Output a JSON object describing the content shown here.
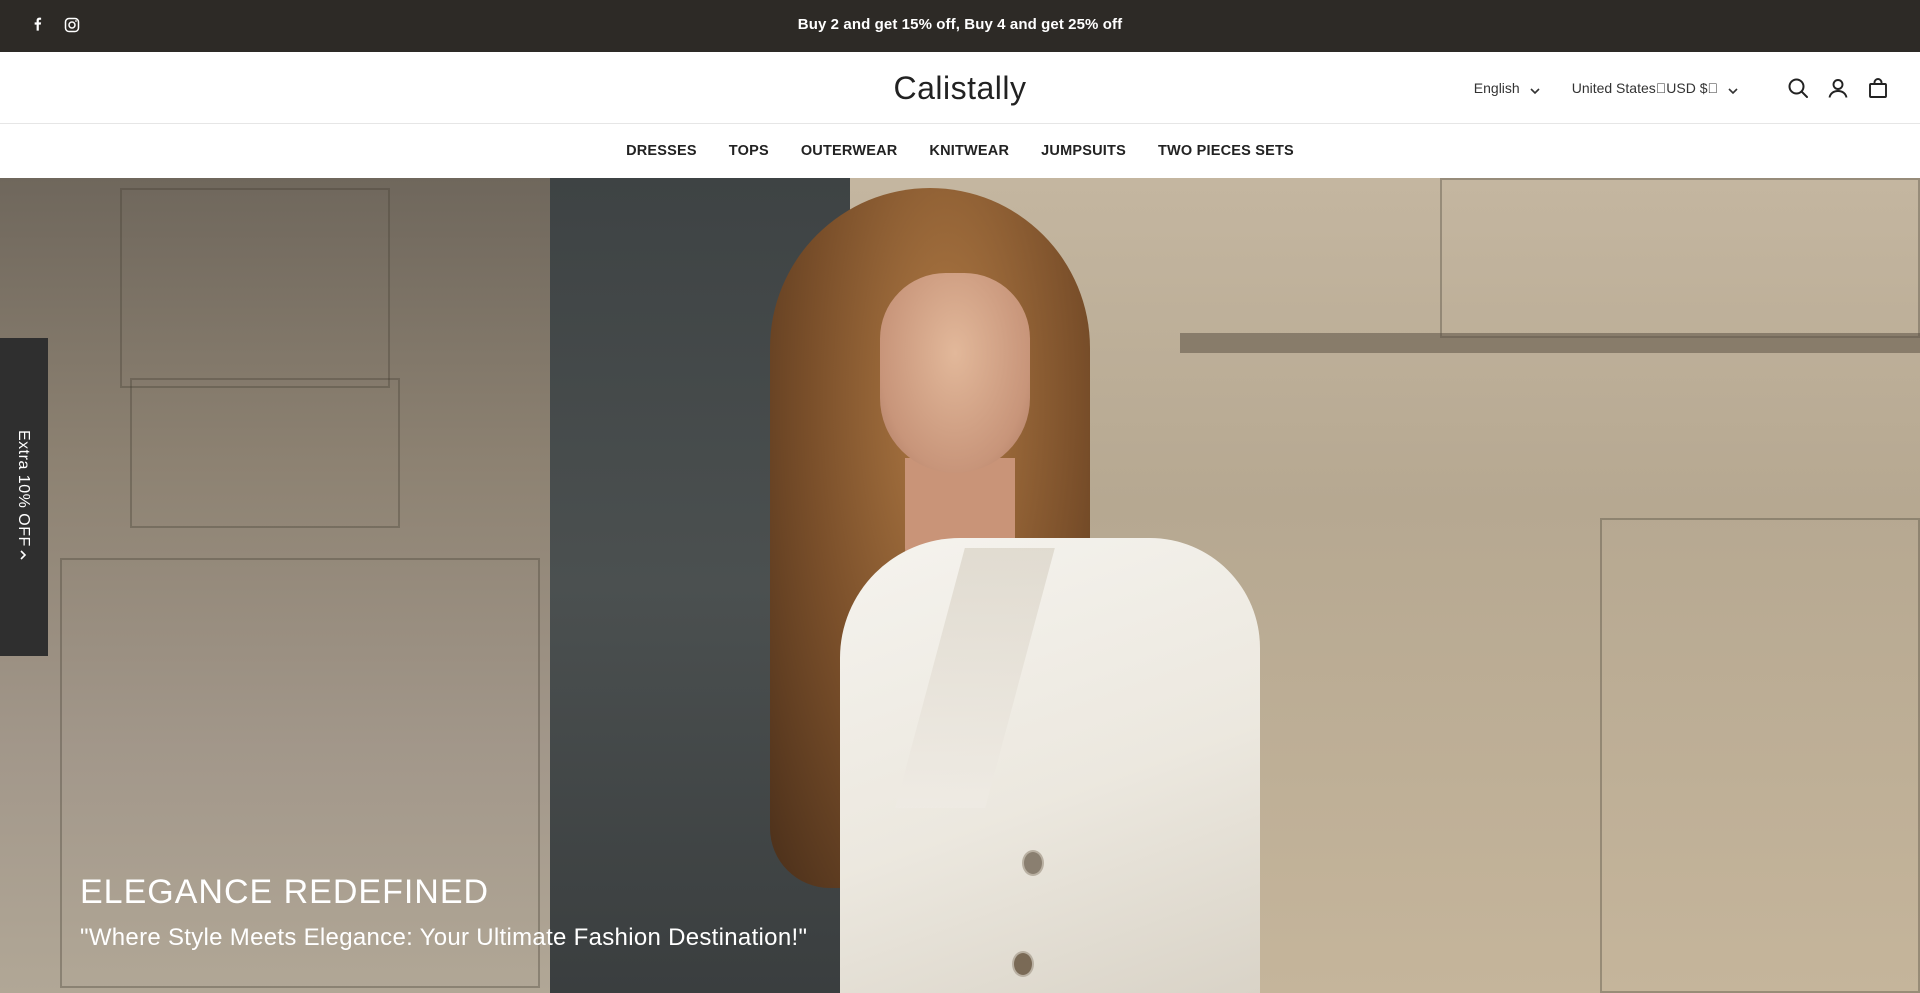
{
  "announcement": {
    "message": "Buy 2 and get 15% off, Buy 4 and get 25% off",
    "social_icons": [
      "facebook-icon",
      "instagram-icon"
    ]
  },
  "header": {
    "logo": "Calistally",
    "language": "English",
    "country_currency": "United States\u0000USD $\u0000",
    "icons": [
      "search-icon",
      "account-icon",
      "cart-icon"
    ]
  },
  "nav": {
    "items": [
      "DRESSES",
      "TOPS",
      "OUTERWEAR",
      "KNITWEAR",
      "JUMPSUITS",
      "TWO PIECES SETS"
    ]
  },
  "side_tab": {
    "label": "Extra 10% OFF"
  },
  "hero": {
    "title": "ELEGANCE REDEFINED",
    "subtitle": "\"Where Style Meets Elegance: Your Ultimate Fashion Destination!\""
  },
  "colors": {
    "announcement_bg": "#2d2a26",
    "side_tab_bg": "#2f2f2f",
    "text_dark": "#222222"
  }
}
